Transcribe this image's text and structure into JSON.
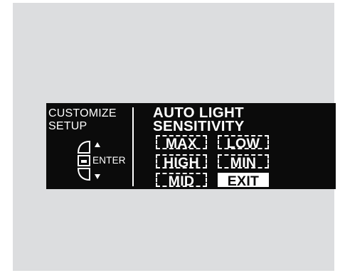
{
  "panel": {
    "background": "#dcdddf"
  },
  "display": {
    "background": "#0b0b0b",
    "text_color": "#ffffff",
    "left": {
      "line1": "CUSTOMIZE",
      "line2": "SETUP",
      "enter_label": "ENTER",
      "up_icon": "arrow-up",
      "down_icon": "arrow-down",
      "enter_icon": "enter-knob"
    },
    "right": {
      "title_line1": "AUTO LIGHT",
      "title_line2": "SENSITIVITY"
    },
    "options": [
      {
        "label": "MAX",
        "style": "dashed"
      },
      {
        "label": "LOW",
        "style": "dashed"
      },
      {
        "label": "HIGH",
        "style": "dashed"
      },
      {
        "label": "MIN",
        "style": "dashed"
      },
      {
        "label": "MID",
        "style": "dashed"
      },
      {
        "label": "EXIT",
        "style": "selected"
      }
    ]
  }
}
